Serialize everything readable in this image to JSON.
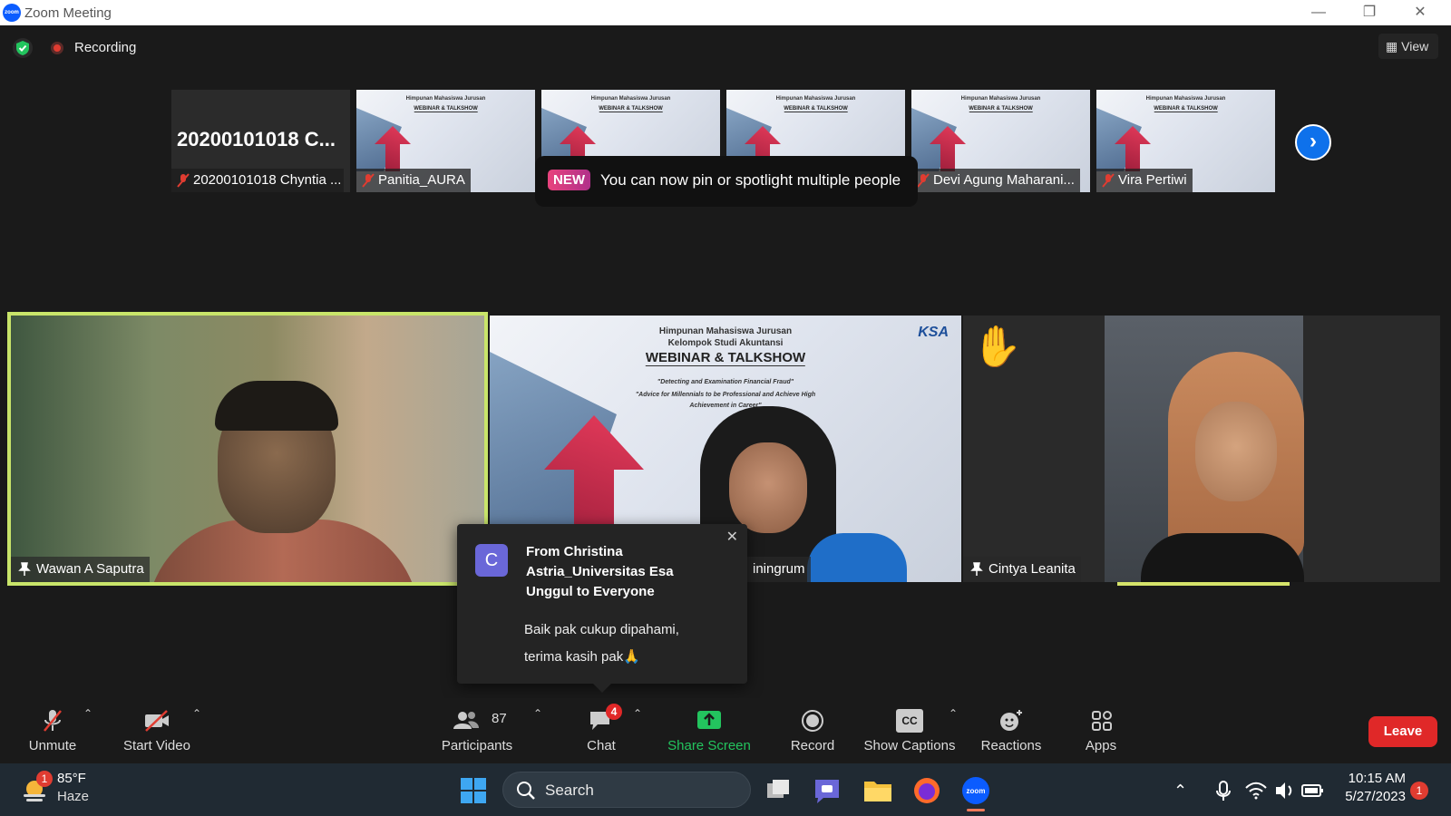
{
  "window": {
    "title": "Zoom Meeting",
    "logo_text": "zoom"
  },
  "status": {
    "recording_label": "Recording",
    "view_label": "View"
  },
  "strip": {
    "thumbnails": [
      {
        "label": "20200101018 Chyntia ...",
        "big_name": "20200101018  C..."
      },
      {
        "label": "Panitia_AURA"
      },
      {
        "label": ""
      },
      {
        "label": ""
      },
      {
        "label": "Devi Agung Maharani..."
      },
      {
        "label": "Vira Pertiwi"
      }
    ],
    "slide_header": "Himpunan Mahasiswa Jurusan",
    "slide_title": "WEBINAR & TALKSHOW"
  },
  "tooltip": {
    "badge": "NEW",
    "message": "You can now pin or spotlight multiple people"
  },
  "main_tiles": {
    "tile1_name": "Wawan A Saputra",
    "tile2_name": "iningrum",
    "tile3_name": "Cintya Leanita",
    "slide_header_line1": "Himpunan Mahasiswa Jurusan",
    "slide_header_line2": "Kelompok Studi Akuntansi",
    "slide_title": "WEBINAR & TALKSHOW",
    "slide_sub1": "\"Detecting and Examination Financial Fraud\"",
    "slide_sub2": "\"Advice for Millennials to be Professional and Achieve High",
    "slide_sub3": "Achievement in Career\"",
    "ksa_logo": "KSA"
  },
  "chat_popup": {
    "avatar_letter": "C",
    "from": "From Christina Astria_Universitas Esa Unggul to Everyone",
    "message_line1": "Baik pak cukup dipahami,",
    "message_line2": "terima kasih pak🙏"
  },
  "toolbar": {
    "unmute": "Unmute",
    "start_video": "Start Video",
    "participants": "Participants",
    "participants_count": "87",
    "chat": "Chat",
    "chat_badge": "4",
    "share_screen": "Share Screen",
    "record": "Record",
    "show_captions": "Show Captions",
    "captions_icon_text": "CC",
    "reactions": "Reactions",
    "apps": "Apps",
    "leave": "Leave"
  },
  "taskbar": {
    "weather_temp": "85°F",
    "weather_desc": "Haze",
    "weather_badge": "1",
    "search_label": "Search",
    "time": "10:15 AM",
    "date": "5/27/2023",
    "notif_badge": "1"
  },
  "colors": {
    "active_speaker": "#c9e56a",
    "leave_red": "#e02828",
    "share_green": "#23c45e",
    "zoom_blue": "#0b5cff"
  }
}
